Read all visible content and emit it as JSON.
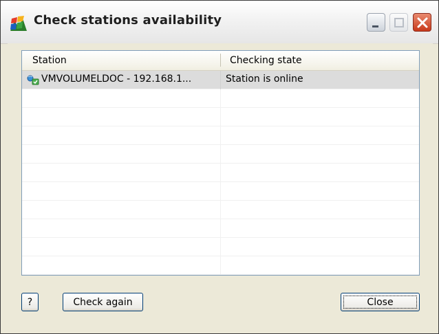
{
  "window": {
    "title": "Check stations availability",
    "title_buttons": [
      "minimize-icon",
      "maximize-icon",
      "close-icon"
    ]
  },
  "list": {
    "columns": [
      "Station",
      "Checking state"
    ],
    "rows": [
      {
        "station": "VMVOLUMELDOC - 192.168.1...",
        "state": "Station is online",
        "icon": "network-station-icon",
        "selected": true
      },
      {
        "station": "",
        "state": ""
      },
      {
        "station": "",
        "state": ""
      },
      {
        "station": "",
        "state": ""
      },
      {
        "station": "",
        "state": ""
      },
      {
        "station": "",
        "state": ""
      },
      {
        "station": "",
        "state": ""
      },
      {
        "station": "",
        "state": ""
      },
      {
        "station": "",
        "state": ""
      },
      {
        "station": "",
        "state": ""
      },
      {
        "station": "",
        "state": ""
      }
    ]
  },
  "buttons": {
    "help_label": "?",
    "check_again_label": "Check again",
    "close_label": "Close"
  },
  "colors": {
    "window_background": "#ece9d8",
    "list_border": "#7f9db9",
    "selected_row": "#dcdcdc",
    "close_button_red": "#c8391a",
    "button_border": "#003c74"
  }
}
